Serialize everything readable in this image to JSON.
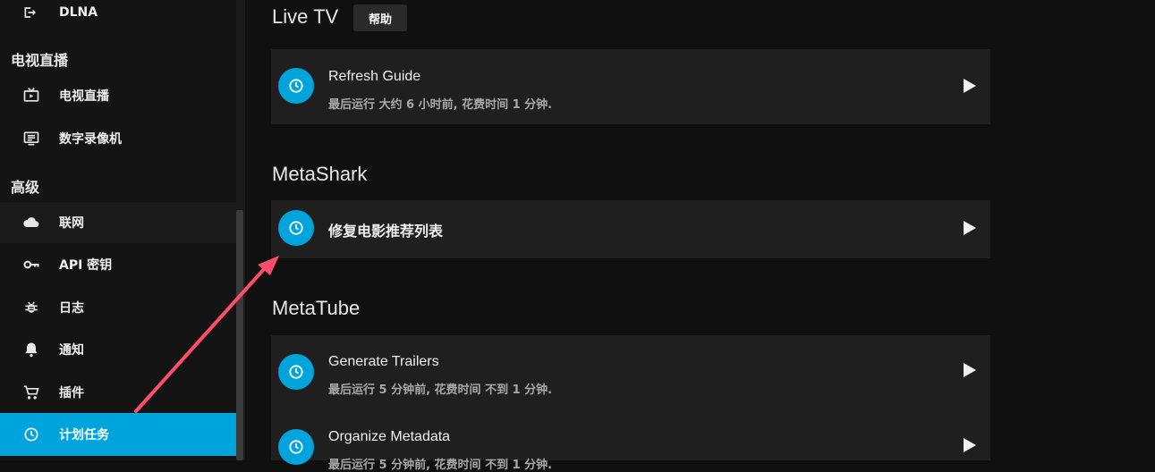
{
  "sidebar": {
    "items_top": [
      {
        "label": "DLNA",
        "icon": "dlna-icon"
      }
    ],
    "section_live": "电视直播",
    "items_live": [
      {
        "label": "电视直播",
        "icon": "tv-icon"
      },
      {
        "label": "数字录像机",
        "icon": "dvr-icon"
      }
    ],
    "section_advanced": "高级",
    "items_advanced": [
      {
        "label": "联网",
        "icon": "cloud-icon"
      },
      {
        "label": "API 密钥",
        "icon": "key-icon"
      },
      {
        "label": "日志",
        "icon": "bug-icon"
      },
      {
        "label": "通知",
        "icon": "bell-icon"
      },
      {
        "label": "插件",
        "icon": "cart-icon"
      },
      {
        "label": "计划任务",
        "icon": "clock-icon",
        "active": true
      }
    ]
  },
  "groups": {
    "livetv": {
      "title": "Live TV",
      "help_label": "帮助",
      "tasks": [
        {
          "name": "Refresh Guide",
          "status": "最后运行 大约 6 小时前, 花费时间 1 分钟."
        }
      ]
    },
    "metashark": {
      "title": "MetaShark",
      "tasks": [
        {
          "name": "修复电影推荐列表",
          "status": ""
        }
      ]
    },
    "metatube": {
      "title": "MetaTube",
      "tasks": [
        {
          "name": "Generate Trailers",
          "status": "最后运行 5 分钟前, 花费时间 不到 1 分钟."
        },
        {
          "name": "Organize Metadata",
          "status": "最后运行 5 分钟前, 花费时间 不到 1 分钟."
        }
      ]
    }
  },
  "colors": {
    "accent": "#00a4dc",
    "card": "#1f1f1f",
    "background": "#101010",
    "annotation_arrow": "#ff4d6a"
  }
}
